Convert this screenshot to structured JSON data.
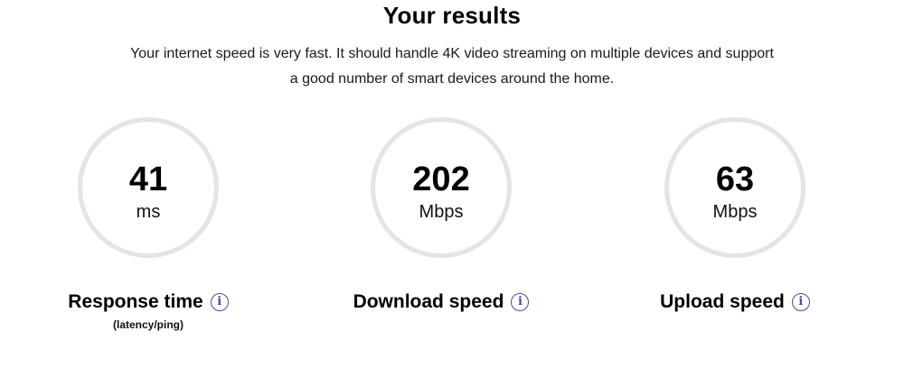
{
  "header": {
    "title": "Your results",
    "description": "Your internet speed is very fast. It should handle 4K video streaming on multiple devices and support a good number of smart devices around the home."
  },
  "metrics": [
    {
      "value": "41",
      "unit": "ms",
      "label": "Response time",
      "sublabel": "(latency/ping)",
      "info_icon": "info-icon",
      "info_glyph": "i"
    },
    {
      "value": "202",
      "unit": "Mbps",
      "label": "Download speed",
      "info_icon": "info-icon",
      "info_glyph": "i"
    },
    {
      "value": "63",
      "unit": "Mbps",
      "label": "Upload speed",
      "info_icon": "info-icon",
      "info_glyph": "i"
    }
  ],
  "colors": {
    "ring": "#e3e3ea",
    "info_icon": "#4b4ba8",
    "text": "#000000"
  }
}
